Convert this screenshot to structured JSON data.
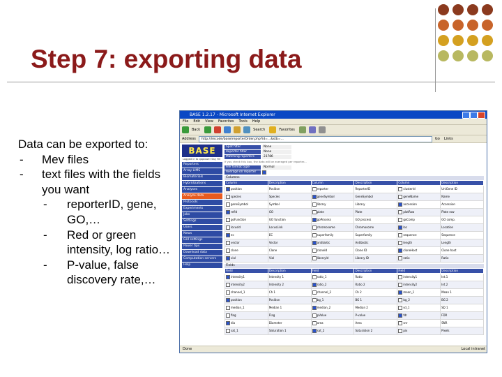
{
  "slide": {
    "title": "Step 7: exporting data",
    "body": {
      "intro": "Data can be exported to:",
      "item1": "Mev files",
      "item2_line1": "text files with the fields",
      "item2_line2": "you want",
      "sub1_line1": "reporterID, gene,",
      "sub1_line2": "GO,…",
      "sub2_line1": "Red or green",
      "sub2_line2": "intensity, log ratio…",
      "sub3_line1": "P-value, false",
      "sub3_line2": "discovery rate,…",
      "dash": "-"
    },
    "dot_colors": [
      "#8b3a1e",
      "#8b3a1e",
      "#8b3a1e",
      "#8b3a1e",
      "#c8642a",
      "#c8642a",
      "#c8642a",
      "#c8642a",
      "#d4a020",
      "#d4a020",
      "#d4a020",
      "#d4a020",
      "#b8b860",
      "#b8b860",
      "#b8b860",
      "#b8b860"
    ]
  },
  "browser": {
    "window_title": "BASE 1.2.17 - Microsoft Internet Explorer",
    "menu": [
      "File",
      "Edit",
      "View",
      "Favorites",
      "Tools",
      "Help"
    ],
    "toolbar": {
      "back_label": "Back",
      "search_label": "Search",
      "favorites_label": "Favorites"
    },
    "address_label": "Address",
    "address_value": "http://lmcode/base/reporterOrder.php?id=...&stb=...",
    "go_label": "Go",
    "links_label": "Links",
    "status_left": "Done",
    "status_right": "Local intranet",
    "logo": "BASE",
    "side_note": "Logged in to qaplower Say Hi!",
    "side_links": [
      "Reporters",
      "Array LIMS",
      "Biomaterials",
      "Hybridizations",
      "Analyses",
      "Analyze data",
      "Protocols",
      "Experiments",
      "Jobs",
      "Settings",
      "Users",
      "News",
      "GUI settings",
      "Power tips"
    ],
    "side_extra": [
      "Download data",
      "Computation servers",
      "Help"
    ],
    "kv": [
      {
        "k": "Spot filter",
        "v": "None"
      },
      {
        "k": "Reporter filter",
        "v": "None"
      },
      {
        "k": "Matching reporters",
        "v": "23786"
      }
    ],
    "file_format": {
      "k": "File format type",
      "v": "Normal"
    },
    "avg_label": "Average on reporter",
    "notes": "If you check this box, the data will be averaged per reporter...",
    "columns_section": "Columns",
    "columns_headers": [
      "Column",
      "Description",
      "Column",
      "Description",
      "Column",
      "Description"
    ],
    "columns_rows": [
      [
        "position",
        "Position",
        "reporter",
        "ReporterID",
        "clusterId",
        "UniGene ID"
      ],
      [
        "species",
        "Species",
        "geneSymbol",
        "GeneSymbol",
        "geneName",
        "Name"
      ],
      [
        "geneSymbol",
        "Symbol",
        "library",
        "Library",
        "accession",
        "Accession"
      ],
      [
        "refId",
        "GO",
        "plate",
        "Plate",
        "platRow",
        "Plate row"
      ],
      [
        "goFunction",
        "GO function",
        "goProcess",
        "GO process",
        "goComp",
        "GO comp."
      ],
      [
        "locusId",
        "LocusLink",
        "chromosome",
        "Chromosome",
        "loc",
        "Location"
      ],
      [
        "ec",
        "EC",
        "superfamily",
        "Superfamily",
        "sequence",
        "Sequence"
      ],
      [
        "vector",
        "Vector",
        "antibiotic",
        "Antibiotic",
        "length",
        "Length"
      ],
      [
        "clone",
        "Clone",
        "cloneId",
        "Clone ID",
        "cloneHost",
        "Clone host"
      ],
      [
        "vial",
        "Vial",
        "libraryId",
        "Library ID",
        "ratio",
        "Ratio"
      ]
    ],
    "fields_section": "Fields",
    "fields_headers": [
      "Field",
      "Description",
      "Field",
      "Description",
      "Field",
      "Description"
    ],
    "fields_rows": [
      [
        "intensity1",
        "Intensity 1",
        "ratio_1",
        "Ratio",
        "intensity1",
        "Int.1"
      ],
      [
        "intensity2",
        "Intensity 2",
        "ratio_2",
        "Ratio 2",
        "intensity2",
        "Int.2"
      ],
      [
        "channel_1",
        "Ch 1",
        "channel_2",
        "Ch 2",
        "mean_1",
        "Mean 1"
      ],
      [
        "position",
        "Position",
        "bg_1",
        "BG 1",
        "bg_2",
        "BG 2"
      ],
      [
        "median_1",
        "Median 1",
        "median_2",
        "Median 2",
        "sd_1",
        "SD 1"
      ],
      [
        "flag",
        "Flag",
        "pValue",
        "P-value",
        "fdr",
        "FDR"
      ],
      [
        "dia",
        "Diameter",
        "area",
        "Area",
        "snr",
        "SNR"
      ],
      [
        "sat_1",
        "Saturation 1",
        "sat_2",
        "Saturation 2",
        "pix",
        "Pixels"
      ]
    ]
  }
}
